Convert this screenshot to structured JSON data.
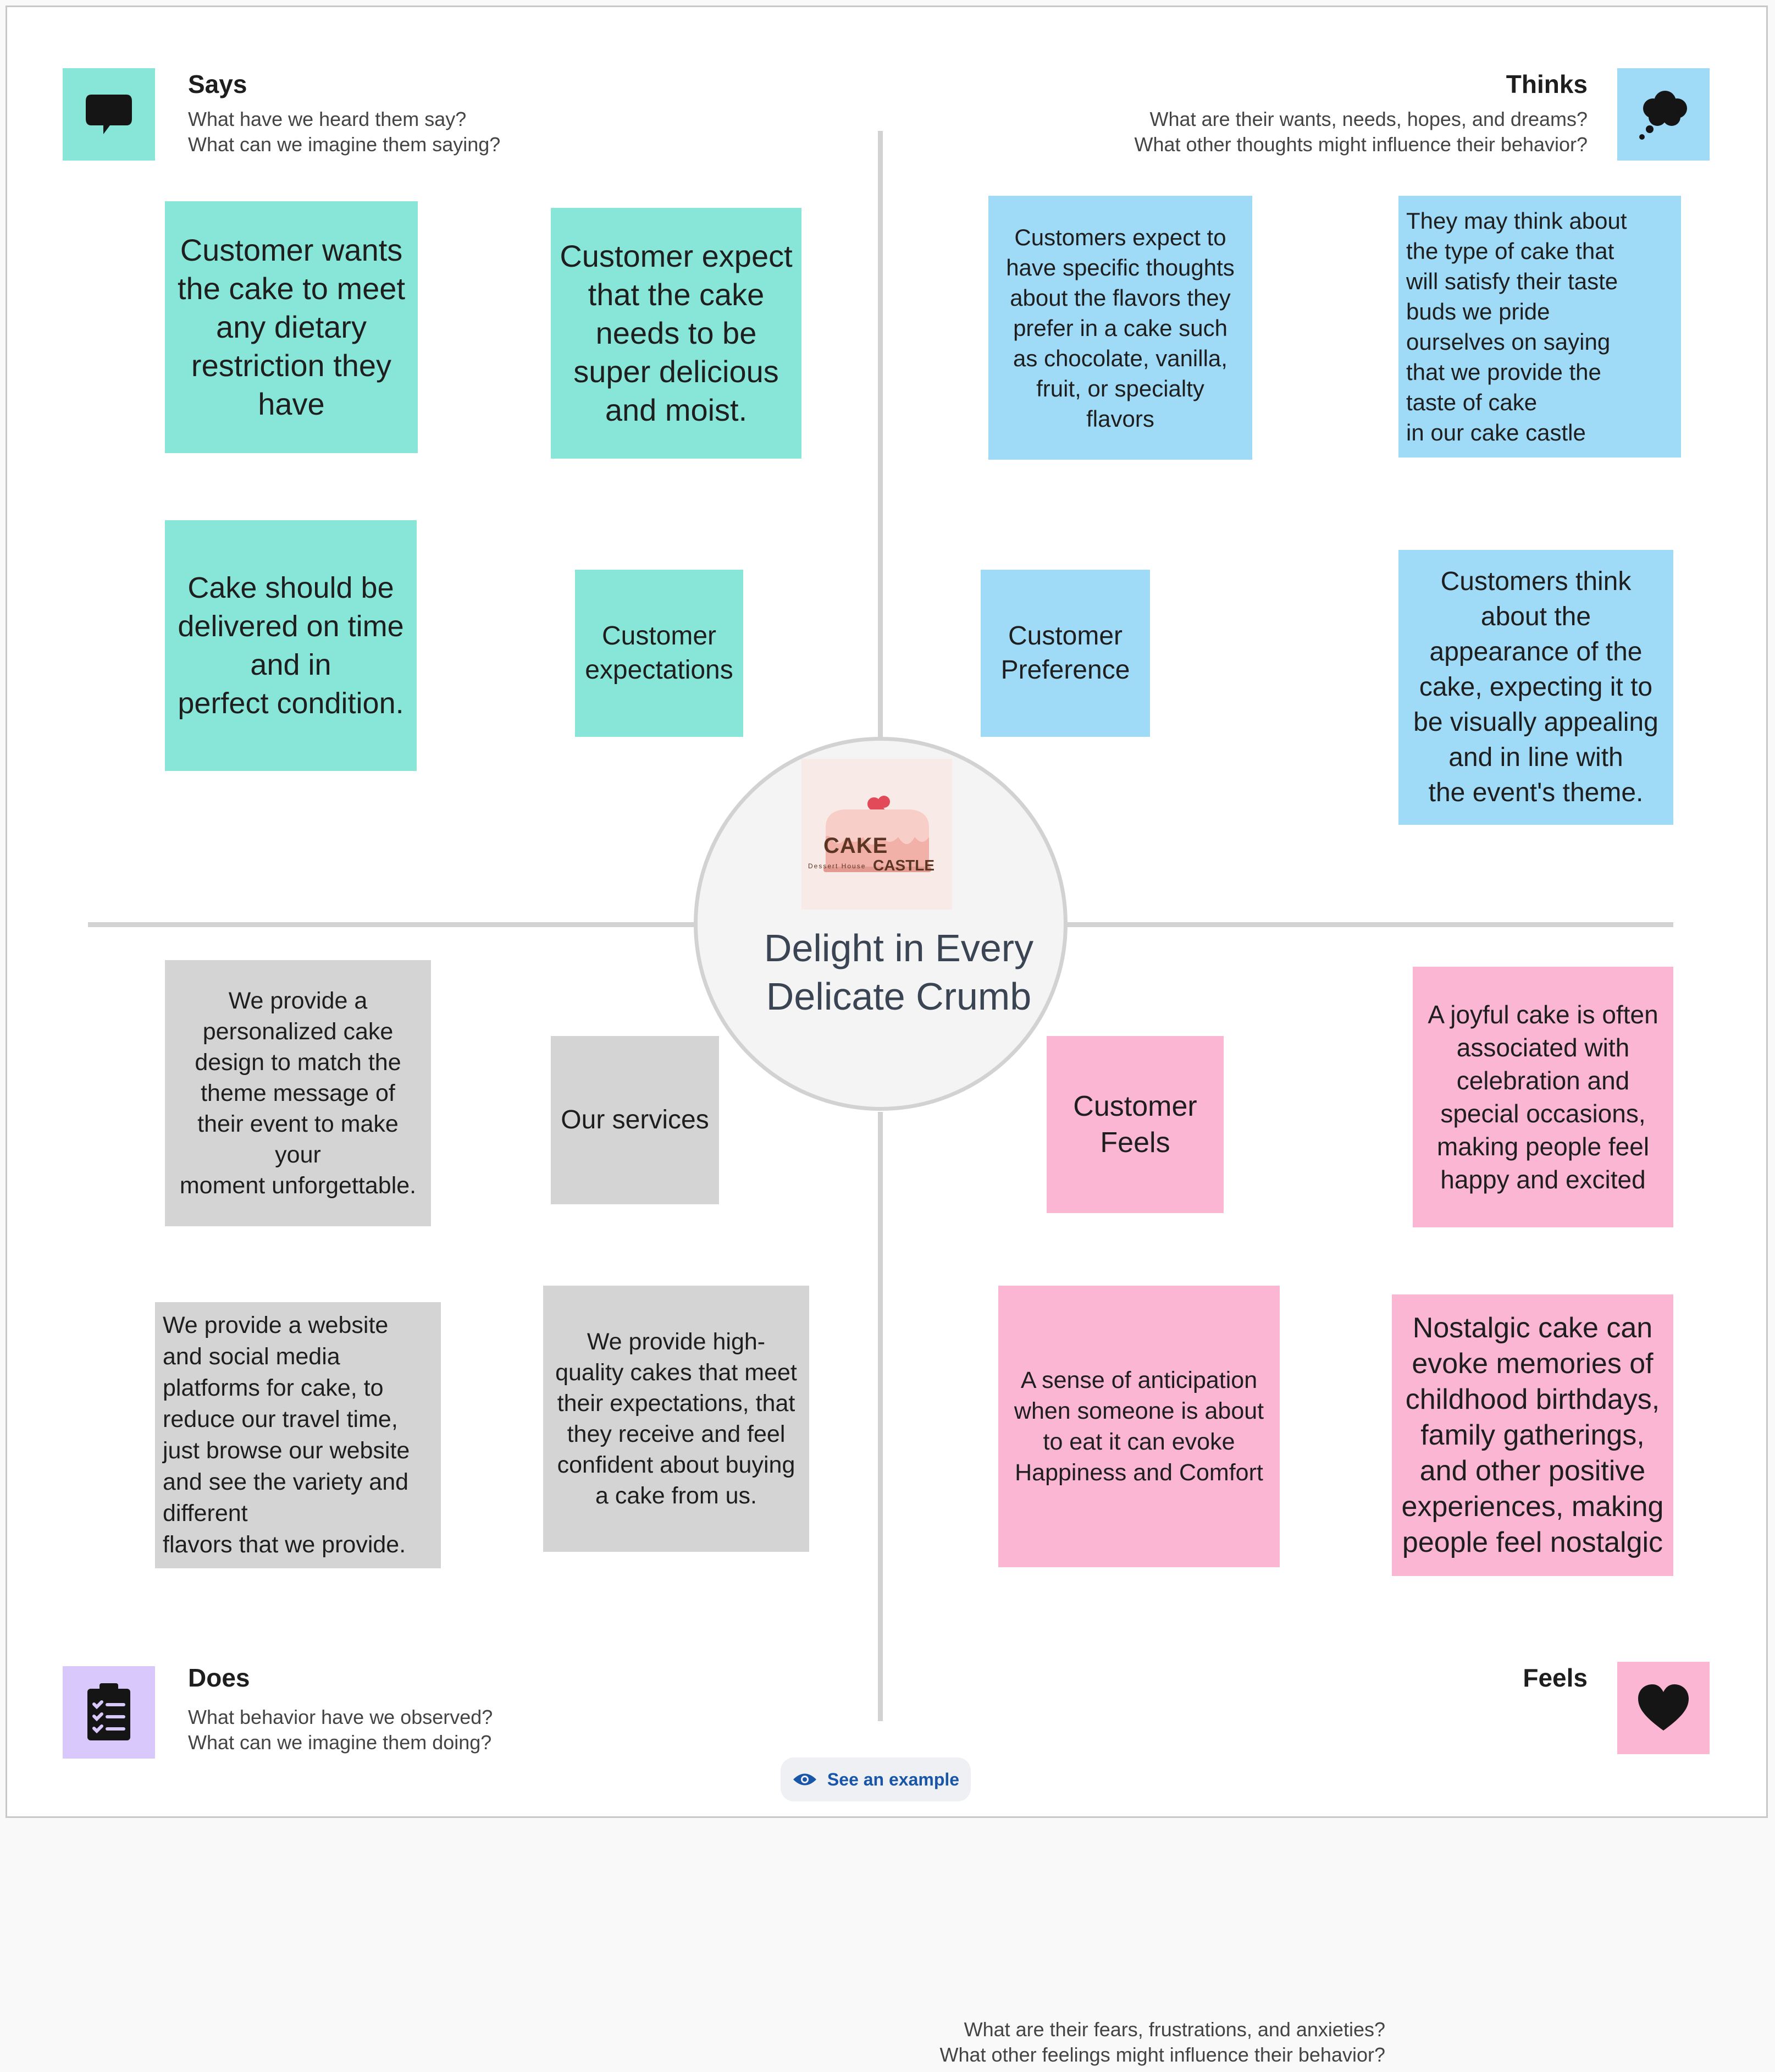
{
  "quadrants": {
    "says": {
      "title": "Says",
      "line1": "What have we heard them say?",
      "line2": "What can we imagine them saying?",
      "icon": "speech-bubble-icon",
      "color": "#88e6d8"
    },
    "thinks": {
      "title": "Thinks",
      "line1": "What are their wants, needs, hopes, and dreams?",
      "line2": "What other thoughts might influence their behavior?",
      "icon": "thought-cloud-icon",
      "color": "#9fdaf7"
    },
    "does": {
      "title": "Does",
      "line1": "What behavior have we observed?",
      "line2": "What can we imagine them doing?",
      "icon": "clipboard-checklist-icon",
      "color": "#d9c8fb"
    },
    "feels": {
      "title": "Feels",
      "line1": "What are their fears, frustrations, and anxieties?",
      "line2": "What other feelings might influence their behavior?",
      "icon": "heart-icon",
      "color": "#fbb6d4"
    }
  },
  "center": {
    "title_line1": "Delight in Every",
    "title_line2": "Delicate Crumb",
    "logo_word1": "CAKE",
    "logo_word2": "CASTLE",
    "logo_tagline": "Dessert House"
  },
  "notes": {
    "says": [
      "Customer wants\nthe cake to meet\nany dietary\nrestriction they\nhave",
      "Customer expect\nthat the cake\nneeds to be\nsuper delicious\nand moist.",
      "Cake should be\ndelivered on time\nand in\nperfect condition.",
      "Customer\nexpectations"
    ],
    "thinks": [
      "Customers expect to\nhave specific thoughts\nabout the flavors they\nprefer in a cake such\nas chocolate, vanilla,\nfruit, or specialty\nflavors",
      "They may think about\nthe type of cake  that\nwill satisfy their taste\nbuds we pride\nourselves on saying\nthat we provide the\ntaste of cake\nin our cake castle",
      "Customer\nPreference",
      "Customers think\nabout the\nappearance of the\ncake, expecting it to\nbe visually appealing\nand in line with\nthe event's theme."
    ],
    "does": [
      "We provide a\npersonalized cake\ndesign to match the\ntheme message of\ntheir event to make\nyour\nmoment unforgettable.",
      "Our services",
      "We provide a website\nand social media\nplatforms for cake, to\nreduce our travel time,\njust browse our website\nand see the variety and\ndifferent\nflavors that we provide.",
      "We provide high-\nquality cakes that meet\ntheir expectations, that\nthey receive and feel\nconfident about buying\na cake from us."
    ],
    "feels": [
      "A joyful cake is often\nassociated with\ncelebration and\nspecial occasions,\nmaking people feel\nhappy and excited",
      "Customer\nFeels",
      "A sense of anticipation\nwhen someone is about\nto eat it can evoke\nHappiness and Comfort",
      "Nostalgic cake can\nevoke memories of\nchildhood birthdays,\nfamily gatherings,\nand other positive\nexperiences, making\npeople feel nostalgic"
    ]
  },
  "example_button": {
    "label": "See an example",
    "icon": "eye-icon"
  },
  "colors": {
    "teal": "#88e6d8",
    "blue": "#9fdaf7",
    "gray": "#d4d4d4",
    "pink": "#fbb6d4",
    "lavender": "#d9c8fb",
    "link": "#1a56a8"
  }
}
